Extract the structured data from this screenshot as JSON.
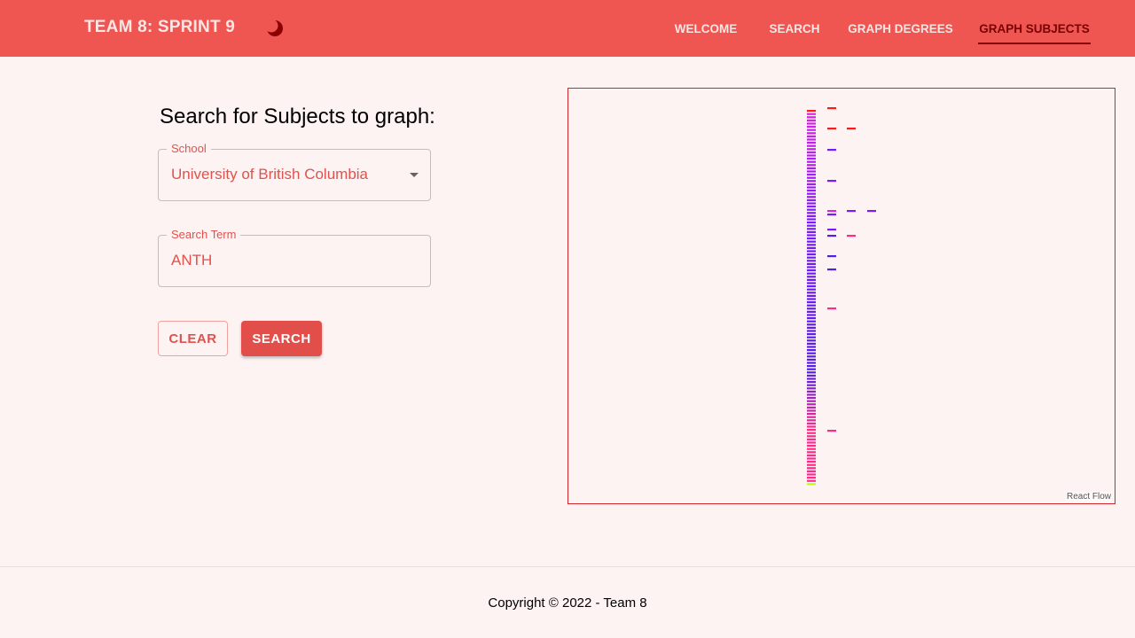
{
  "header": {
    "brand": "TEAM 8: SPRINT 9",
    "theme_icon": "moon-icon",
    "nav": [
      {
        "label": "WELCOME",
        "active": false
      },
      {
        "label": "SEARCH",
        "active": false
      },
      {
        "label": "GRAPH DEGREES",
        "active": false
      },
      {
        "label": "GRAPH SUBJECTS",
        "active": true
      }
    ]
  },
  "form": {
    "title": "Search for Subjects to graph:",
    "school": {
      "label": "School",
      "value": "University of British Columbia"
    },
    "term": {
      "label": "Search Term",
      "value": "ANTH"
    },
    "clear_label": "CLEAR",
    "search_label": "SEARCH"
  },
  "graph": {
    "attribution": "React Flow",
    "colors": {
      "border": "#d3262c",
      "red": "#ff1a1a",
      "magenta": "#e020e8",
      "purple": "#7a1aff",
      "blue": "#5320e6",
      "pink": "#ff2a8a",
      "lime": "#b8ff1a"
    }
  },
  "footer": {
    "copyright": "Copyright © 2022 - Team 8"
  },
  "colors": {
    "appbar": "#f05651",
    "accent": "#e24f4b",
    "background": "#fdf3f2",
    "active_nav": "#7a0000"
  }
}
